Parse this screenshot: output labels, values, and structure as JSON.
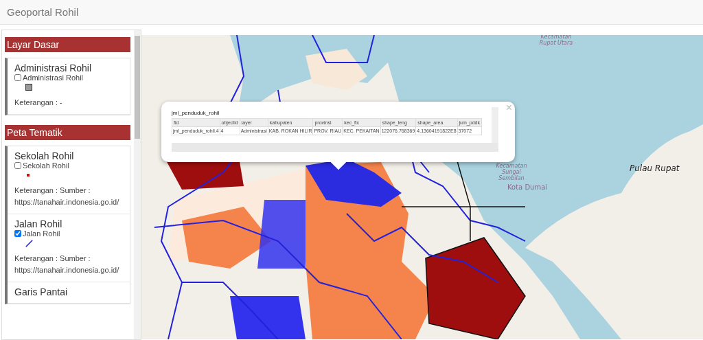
{
  "header": {
    "title": "Geoportal Rohil"
  },
  "sidebar": {
    "sections": [
      {
        "title": "Layar Dasar",
        "layers": [
          {
            "name": "Administrasi Rohil",
            "checkbox_label": "Administrasi Rohil",
            "checked": false,
            "kind": "polygon",
            "color": "#999999",
            "note": "Keterangan : -"
          }
        ]
      },
      {
        "title": "Peta Tematik",
        "layers": [
          {
            "name": "Sekolah Rohil",
            "checkbox_label": "Sekolah Rohil",
            "checked": false,
            "kind": "point",
            "color": "#cc1111",
            "note": "Keterangan : Sumber : https://tanahair.indonesia.go.id/"
          },
          {
            "name": "Jalan Rohil",
            "checkbox_label": "Jalan Rohil",
            "checked": true,
            "kind": "line",
            "color": "#2222cc",
            "note": "Keterangan : Sumber : https://tanahair.indonesia.go.id/"
          },
          {
            "name": "Garis Pantai"
          }
        ]
      }
    ]
  },
  "map": {
    "labels": [
      {
        "text": "Kecamatan Rupat Utara",
        "kind": "district"
      },
      {
        "text": "Kecamatan Sungai Sembilan",
        "kind": "district"
      },
      {
        "text": "Kota Dumai",
        "kind": "city"
      },
      {
        "text": "Pulau Rupat",
        "kind": "island"
      }
    ]
  },
  "popup": {
    "title": "jml_penduduk_rohil",
    "close": "×",
    "table": {
      "columns": [
        "fid",
        "objectid",
        "layer",
        "kabupaten",
        "provinsi",
        "kec_fix",
        "shape_leng",
        "shape_area",
        "jum_pddk"
      ],
      "rows": [
        [
          "jml_penduduk_rohil.4",
          "4",
          "Administrasi",
          "KAB. ROKAN HILIR",
          "PROV. RIAU",
          "KEC. PEKAITAN",
          "122076.768369",
          "4.13604191822E8",
          "37072"
        ]
      ]
    }
  }
}
